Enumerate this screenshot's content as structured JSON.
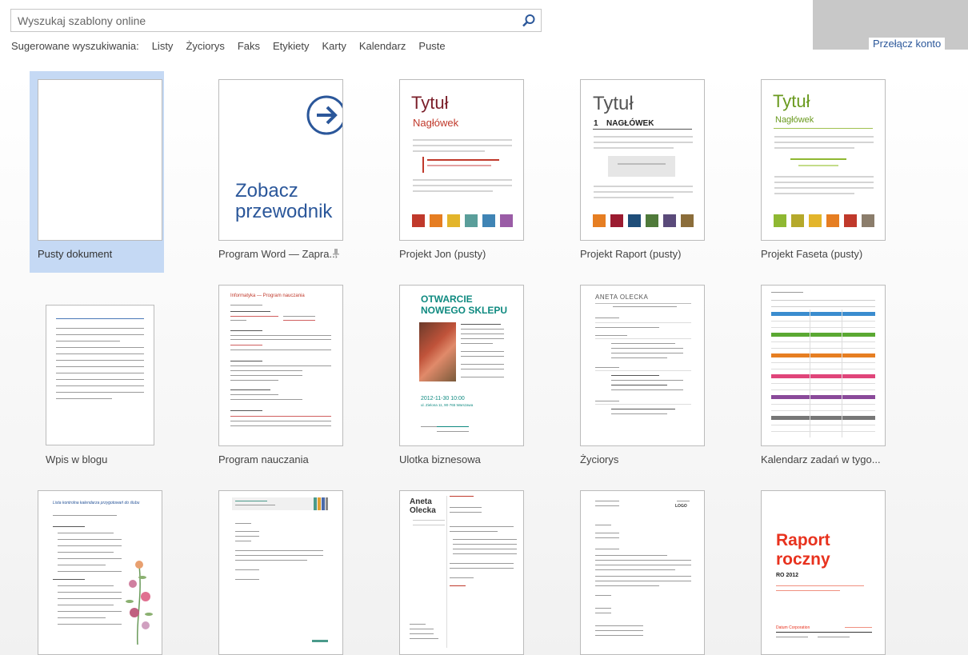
{
  "search": {
    "placeholder": "Wyszukaj szablony online"
  },
  "suggested": {
    "label": "Sugerowane wyszukiwania:",
    "links": [
      "Listy",
      "Życiorys",
      "Faks",
      "Etykiety",
      "Karty",
      "Kalendarz",
      "Puste"
    ]
  },
  "account": {
    "switch_label": "Przełącz konto"
  },
  "templates": {
    "blank": {
      "caption": "Pusty dokument"
    },
    "tour": {
      "caption": "Program Word — Zapra...",
      "thumb_line1": "Zobacz",
      "thumb_line2": "przewodnik"
    },
    "jon": {
      "caption": "Projekt Jon (pusty)",
      "title": "Tytuł",
      "heading": "Nagłówek",
      "swatches": [
        "#c0392b",
        "#e67e22",
        "#e3b52b",
        "#5a9e9a",
        "#3f84b5",
        "#9a5ca6"
      ]
    },
    "report": {
      "caption": "Projekt Raport (pusty)",
      "title": "Tytuł",
      "heading_num": "1",
      "heading": "NAGŁÓWEK",
      "swatches": [
        "#e67e22",
        "#9b1b30",
        "#1f4e79",
        "#4f7a3a",
        "#5a4a7a",
        "#8b6d3a"
      ]
    },
    "facet": {
      "caption": "Projekt Faseta (pusty)",
      "title": "Tytuł",
      "heading": "Nagłówek",
      "swatches": [
        "#8fb832",
        "#b5a92b",
        "#e3b52b",
        "#e67e22",
        "#c0392b",
        "#8b7d6b"
      ]
    },
    "blog": {
      "caption": "Wpis w blogu"
    },
    "syllabus": {
      "caption": "Program nauczania",
      "title": "Informatyka — Program nauczania"
    },
    "flyer": {
      "caption": "Ulotka biznesowa",
      "title_line1": "OTWARCIE",
      "title_line2": "NOWEGO SKLEPU",
      "date": "2012-11-30 10:00",
      "address": "ul. Zielona 11, 90-765 Warszawa"
    },
    "resume": {
      "caption": "Życiorys",
      "name": "ANETA OLECKA"
    },
    "calendar": {
      "caption": "Kalendarz zadań w tygo..."
    },
    "checklist": {
      "caption": "",
      "title": "Lista kontrolna kalendarza przygotowań do ślubu"
    },
    "letter": {
      "caption": ""
    },
    "coverletter": {
      "caption": "",
      "name_line1": "Aneta",
      "name_line2": "Olecka"
    },
    "businessletter": {
      "caption": "",
      "logo": "LOGO"
    },
    "annual": {
      "caption": "",
      "title_line1": "Raport",
      "title_line2": "roczny",
      "year": "RO 2012",
      "company": "Datum Corporation"
    }
  }
}
